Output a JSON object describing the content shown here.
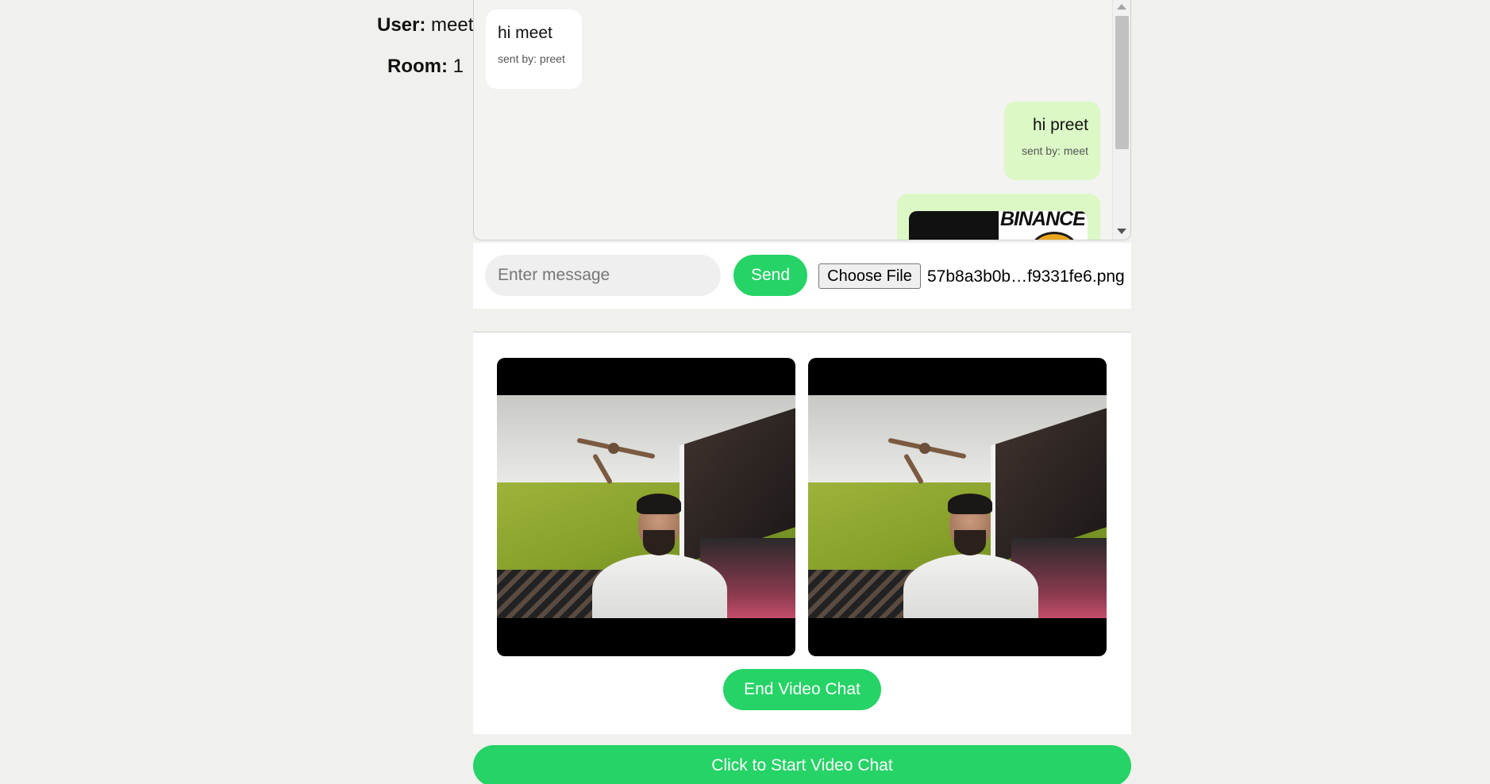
{
  "info": {
    "user_label": "User:",
    "user_value": "meet",
    "room_label": "Room:",
    "room_value": "1"
  },
  "chat": {
    "messages": [
      {
        "text": "hi meet",
        "sender": "sent by: preet",
        "side": "left"
      },
      {
        "text": "hi preet",
        "sender": "sent by: meet",
        "side": "right"
      },
      {
        "type": "image",
        "image_text": "BINANCE",
        "side": "right"
      }
    ]
  },
  "composer": {
    "placeholder": "Enter message",
    "send_label": "Send",
    "file_button_label": "Choose File",
    "file_name": "57b8a3b0b…f9331fe6.png"
  },
  "video": {
    "end_label": "End Video Chat"
  },
  "start_label": "Click to Start Video Chat",
  "colors": {
    "accent": "#25d366",
    "outgoing_bubble": "#dcf8c6",
    "incoming_bubble": "#ffffff",
    "background": "#f0f0ed"
  }
}
